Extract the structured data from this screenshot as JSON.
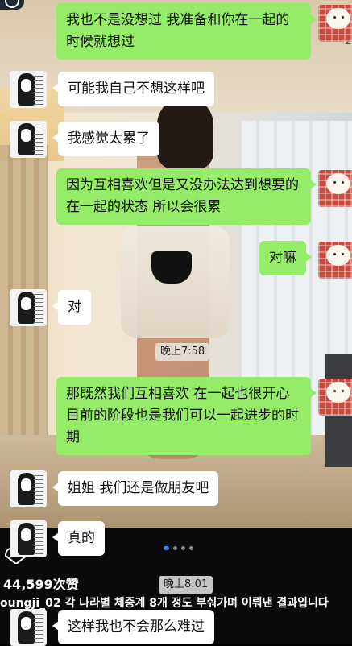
{
  "messages": [
    {
      "side": "right",
      "text": "我也不是没想过 我准备和你在一起的时候就想过"
    },
    {
      "side": "left",
      "text": "可能我自己不想这样吧"
    },
    {
      "side": "left",
      "text": "我感觉太累了"
    },
    {
      "side": "right",
      "text": "因为互相喜欢但是又没办法达到想要的在一起的状态 所以会很累"
    },
    {
      "side": "right",
      "text": "对嘛"
    },
    {
      "side": "left",
      "text": "对"
    },
    {
      "side": "right",
      "text": "那既然我们互相喜欢 在一起也很开心 目前的阶段也是我们可以一起进步的时期"
    },
    {
      "side": "left",
      "text": "姐姐 我们还是做朋友吧"
    },
    {
      "side": "left",
      "text": "真的"
    },
    {
      "side": "left",
      "text": "这样我也不会那么难过"
    }
  ],
  "timestamps": [
    "晚上7:58",
    "晚上8:01"
  ],
  "edge_number": "2",
  "background": {
    "likes": "44,599次赞",
    "comment": "oungji_02 각 나라별 체중계 8개 정도 부숴가며 이뤄낸 결과입니다"
  },
  "avatars": {
    "left": "anime-girl-avatar",
    "right": "sheep-plush-avatar"
  }
}
